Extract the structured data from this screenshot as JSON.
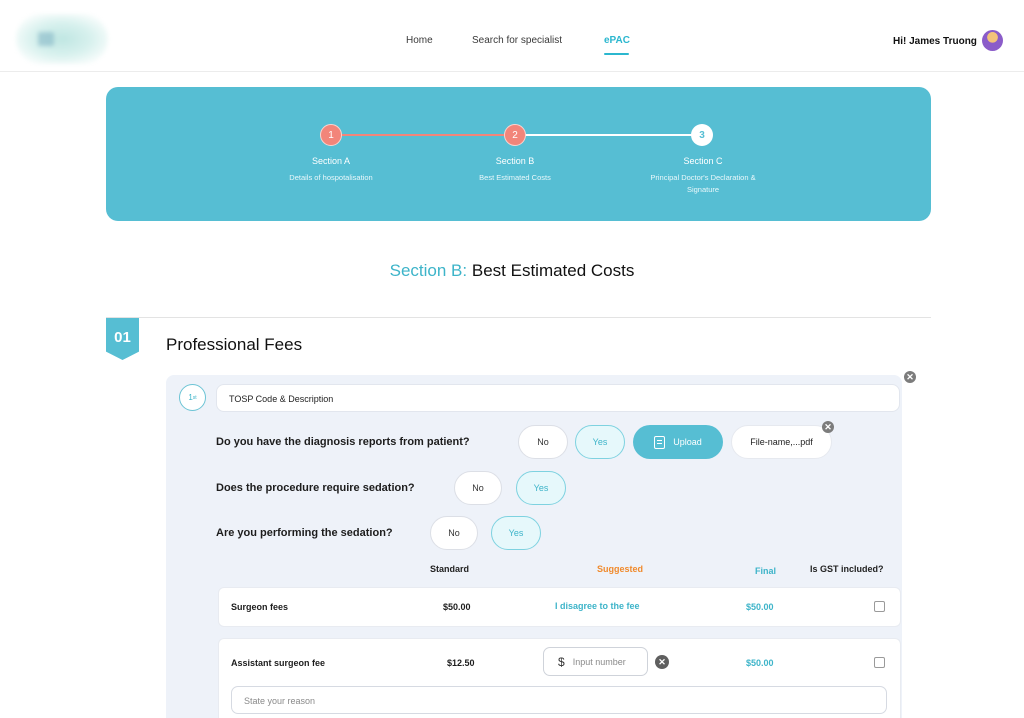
{
  "header": {
    "nav": [
      "Home",
      "Search for specialist",
      "ePAC"
    ],
    "active_nav": "ePAC",
    "greeting": "Hi! James Truong"
  },
  "stepper": {
    "steps": [
      {
        "number": "1",
        "title": "Section A",
        "subtitle": "Details of hospotalisation",
        "state": "completed"
      },
      {
        "number": "2",
        "title": "Section B",
        "subtitle": "Best Estimated Costs",
        "state": "current"
      },
      {
        "number": "3",
        "title": "Section C",
        "subtitle": "Principal Doctor's Declaration & Signature",
        "state": "upcoming"
      }
    ]
  },
  "section": {
    "prefix": "Section B:",
    "title": "Best Estimated Costs"
  },
  "fees": {
    "badge": "01",
    "title": "Professional Fees",
    "ordinal": "1",
    "ordinal_suffix": "st",
    "tosp_value": "TOSP Code & Description",
    "questions": [
      {
        "text": "Do you have the diagnosis reports from patient?",
        "no": "No",
        "yes": "Yes",
        "selected": "Yes",
        "upload": "Upload",
        "file": "File-name,...pdf"
      },
      {
        "text": "Does the procedure require sedation?",
        "no": "No",
        "yes": "Yes",
        "selected": "Yes"
      },
      {
        "text": "Are you performing the sedation?",
        "no": "No",
        "yes": "Yes",
        "selected": "Yes"
      }
    ],
    "columns": {
      "standard": "Standard",
      "suggested": "Suggested",
      "final": "Final",
      "gst": "Is GST included?"
    },
    "rows": [
      {
        "label": "Surgeon fees",
        "standard": "$50.00",
        "suggested": "I disagree to the fee",
        "final": "$50.00",
        "gst_included": false
      },
      {
        "label": "Assistant surgeon fee",
        "standard": "$12.50",
        "input_symbol": "$",
        "input_placeholder": "Input number",
        "final": "$50.00",
        "gst_included": false,
        "reason_placeholder": "State your reason"
      }
    ]
  },
  "colors": {
    "accent": "#56bed3",
    "accent_text": "#3db4c9",
    "step_done": "#f2857a",
    "suggested_header": "#f08a2c",
    "card_bg": "#eef2f9"
  }
}
